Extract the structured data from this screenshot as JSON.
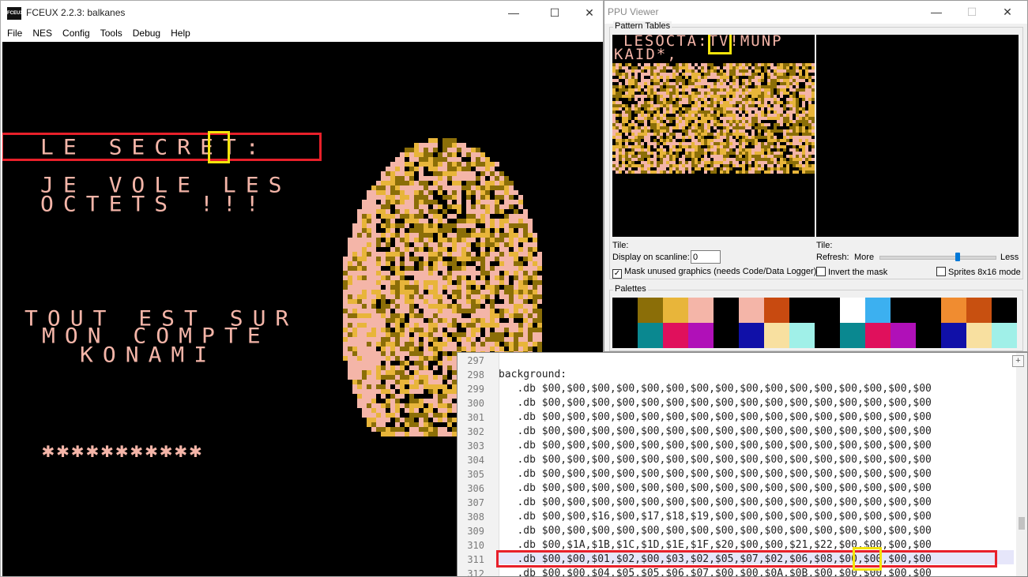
{
  "fceux": {
    "title": "FCEUX 2.2.3: balkanes",
    "app_icon_text": "FCEUX",
    "menu": [
      "File",
      "NES",
      "Config",
      "Tools",
      "Debug",
      "Help"
    ],
    "window_buttons": [
      "—",
      "☐",
      "✕"
    ],
    "screen": {
      "line1": "LE SECRET:",
      "line2": "JE VOLE LES",
      "line3": "OCTETS !!!",
      "line4": "TOUT EST SUR",
      "line5": "MON COMPTE",
      "line6": "KONAMI",
      "stars": "✱✱✱✱✱✱✱✱✱✱✱"
    }
  },
  "ppu": {
    "title": "PPU Viewer",
    "window_buttons": [
      "—",
      "☐",
      "✕"
    ],
    "pattern_tables_label": "Pattern Tables",
    "pattern_text_line1": "LESOCTA:TV!MUNP",
    "pattern_text_line2": "KAID*,",
    "tile_left": "Tile:",
    "tile_right": "Tile:",
    "scanline_label": "Display on scanline:",
    "scanline_value": "0",
    "refresh_label": "Refresh:",
    "refresh_more": "More",
    "refresh_less": "Less",
    "refresh_level": 0.67,
    "mask_unused_label": "Mask unused graphics (needs Code/Data Logger)",
    "mask_unused_checked": true,
    "invert_mask_label": "Invert the mask",
    "invert_mask_checked": false,
    "sprites_label": "Sprites 8x16 mode",
    "sprites_checked": false,
    "palettes_label": "Palettes",
    "palette_row1": [
      "#000000",
      "#8b6e08",
      "#e8b53a",
      "#f4b5a8",
      "#000000",
      "#f4b5a8",
      "#c84a10",
      "#000000",
      "#000000",
      "#ffffff",
      "#3cb0f0",
      "#000000",
      "#000000",
      "#f08c30",
      "#c85010",
      "#000000"
    ],
    "palette_row2": [
      "#000000",
      "#0a8890",
      "#e0105c",
      "#b010b8",
      "#000000",
      "#1010a8",
      "#f8e0a0",
      "#a0f0e8",
      "#000000",
      "#0a8890",
      "#e0105c",
      "#b010b8",
      "#000000",
      "#1010a8",
      "#f8e0a0",
      "#a0f0e8"
    ]
  },
  "editor": {
    "plus_label": "+",
    "lines": [
      {
        "num": "297",
        "text": ""
      },
      {
        "num": "298",
        "text": "background:"
      },
      {
        "num": "299",
        "text": "   .db $00,$00,$00,$00,$00,$00,$00,$00,$00,$00,$00,$00,$00,$00,$00,$00"
      },
      {
        "num": "300",
        "text": "   .db $00,$00,$00,$00,$00,$00,$00,$00,$00,$00,$00,$00,$00,$00,$00,$00"
      },
      {
        "num": "301",
        "text": "   .db $00,$00,$00,$00,$00,$00,$00,$00,$00,$00,$00,$00,$00,$00,$00,$00"
      },
      {
        "num": "302",
        "text": "   .db $00,$00,$00,$00,$00,$00,$00,$00,$00,$00,$00,$00,$00,$00,$00,$00"
      },
      {
        "num": "303",
        "text": "   .db $00,$00,$00,$00,$00,$00,$00,$00,$00,$00,$00,$00,$00,$00,$00,$00"
      },
      {
        "num": "304",
        "text": "   .db $00,$00,$00,$00,$00,$00,$00,$00,$00,$00,$00,$00,$00,$00,$00,$00"
      },
      {
        "num": "305",
        "text": "   .db $00,$00,$00,$00,$00,$00,$00,$00,$00,$00,$00,$00,$00,$00,$00,$00"
      },
      {
        "num": "306",
        "text": "   .db $00,$00,$00,$00,$00,$00,$00,$00,$00,$00,$00,$00,$00,$00,$00,$00"
      },
      {
        "num": "307",
        "text": "   .db $00,$00,$00,$00,$00,$00,$00,$00,$00,$00,$00,$00,$00,$00,$00,$00"
      },
      {
        "num": "308",
        "text": "   .db $00,$00,$16,$00,$17,$18,$19,$00,$00,$00,$00,$00,$00,$00,$00,$00"
      },
      {
        "num": "309",
        "text": "   .db $00,$00,$00,$00,$00,$00,$00,$00,$00,$00,$00,$00,$00,$00,$00,$00"
      },
      {
        "num": "310",
        "text": "   .db $00,$1A,$1B,$1C,$1D,$1E,$1F,$20,$00,$00,$21,$22,$00,$00,$00,$00"
      },
      {
        "num": "311",
        "text": "   .db $00,$00,$01,$02,$00,$03,$02,$05,$07,$02,$06,$08,$00,$00,$00,$00"
      },
      {
        "num": "312",
        "text": "   .db $00,$00,$04,$05,$05,$06,$07,$00,$00,$0A,$0B,$00,$00,$00,$00,$00"
      }
    ]
  },
  "colors": {
    "nes_pink": "#f4b5a8",
    "nes_gold": "#e8b53a",
    "nes_olive": "#8b6e08",
    "highlight_red": "#e8202a",
    "highlight_yellow": "#f4e40c"
  }
}
